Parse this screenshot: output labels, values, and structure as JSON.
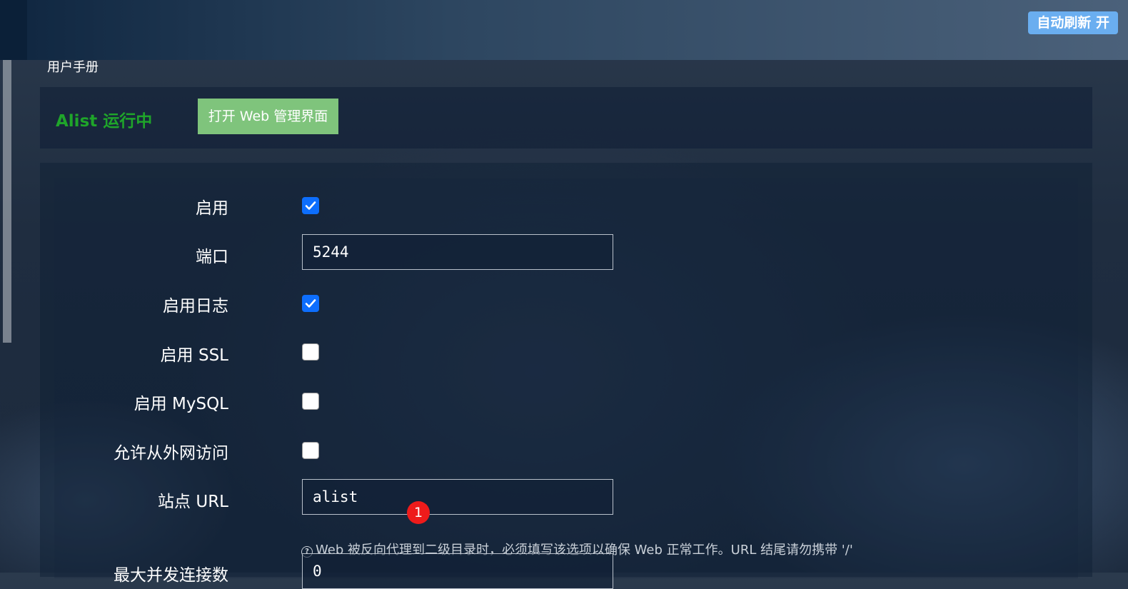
{
  "topbar": {
    "autorefresh_label": "自动刷新 开"
  },
  "nav": {
    "manual_link": "用户手册"
  },
  "status": {
    "text": "Alist 运行中",
    "open_web_button": "打开 Web 管理界面"
  },
  "form": {
    "enable": {
      "label": "启用",
      "checked": true
    },
    "port": {
      "label": "端口",
      "value": "5244"
    },
    "log": {
      "label": "启用日志",
      "checked": true
    },
    "ssl": {
      "label": "启用 SSL",
      "checked": false
    },
    "mysql": {
      "label": "启用 MySQL",
      "checked": false
    },
    "external": {
      "label": "允许从外网访问",
      "checked": false
    },
    "site_url": {
      "label": "站点 URL",
      "value": "alist",
      "badge": "1",
      "help": "Web 被反向代理到二级目录时，必须填写该选项以确保 Web 正常工作。URL 结尾请勿携带 '/'"
    },
    "max_conn": {
      "label": "最大并发连接数",
      "value": "0"
    }
  },
  "colors": {
    "accent": "#0d6efd",
    "status_green": "#1fa52a",
    "button_green": "#7fc47c",
    "autorefresh_blue": "#6aaef0"
  }
}
